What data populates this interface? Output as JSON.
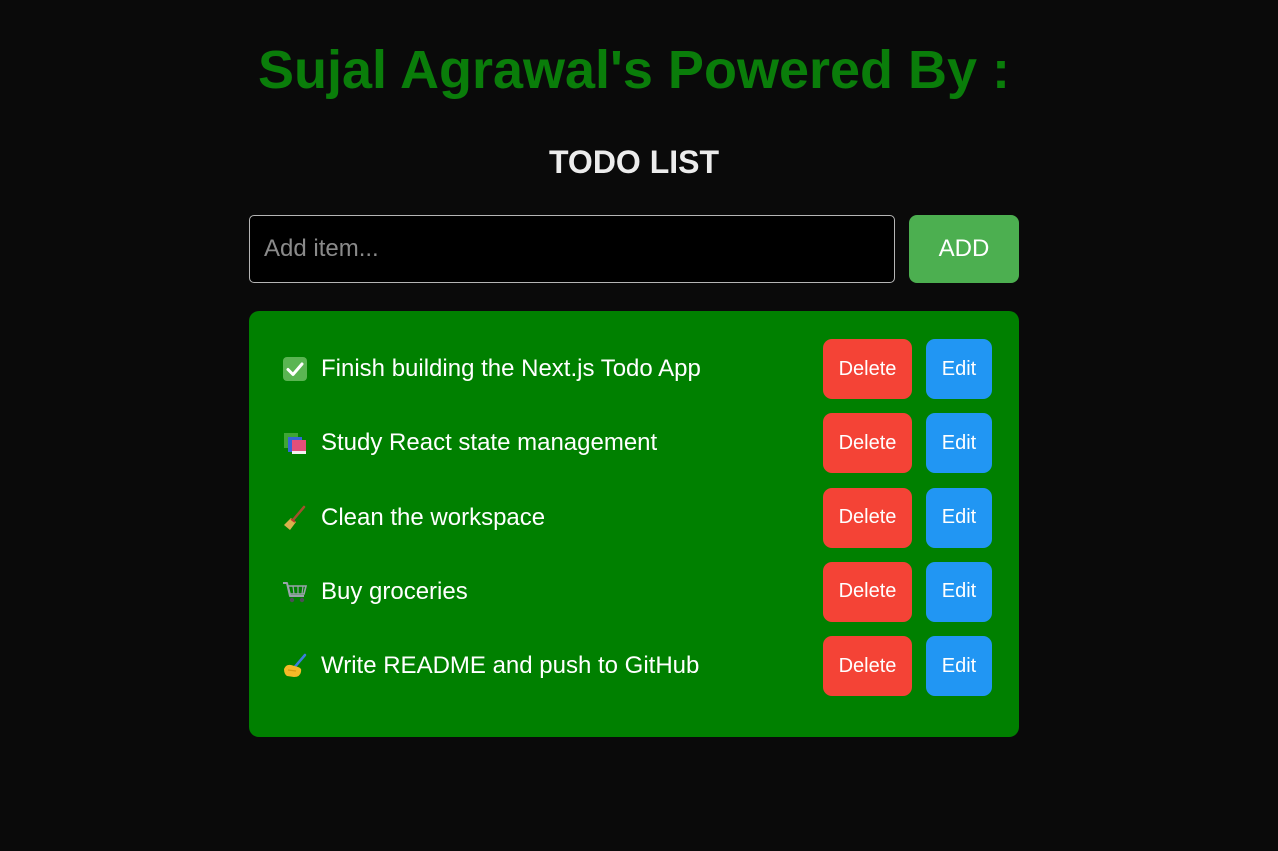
{
  "header": {
    "title": "Sujal Agrawal's Powered By :",
    "subtitle": "TODO LIST"
  },
  "add_form": {
    "placeholder": "Add item...",
    "value": "",
    "add_label": "ADD"
  },
  "todos": [
    {
      "icon": "check-box-icon",
      "text": "Finish building the Next.js Todo App",
      "delete_label": "Delete",
      "edit_label": "Edit"
    },
    {
      "icon": "books-icon",
      "text": "Study React state management",
      "delete_label": "Delete",
      "edit_label": "Edit"
    },
    {
      "icon": "broom-icon",
      "text": "Clean the workspace",
      "delete_label": "Delete",
      "edit_label": "Edit"
    },
    {
      "icon": "shopping-cart-icon",
      "text": "Buy groceries",
      "delete_label": "Delete",
      "edit_label": "Edit"
    },
    {
      "icon": "writing-hand-icon",
      "text": "Write README and push to GitHub",
      "delete_label": "Delete",
      "edit_label": "Edit"
    }
  ],
  "colors": {
    "background": "#0a0a0a",
    "title": "#0a7d0a",
    "panel": "#008000",
    "add_button": "#4caf50",
    "delete_button": "#f44336",
    "edit_button": "#2196f3"
  }
}
